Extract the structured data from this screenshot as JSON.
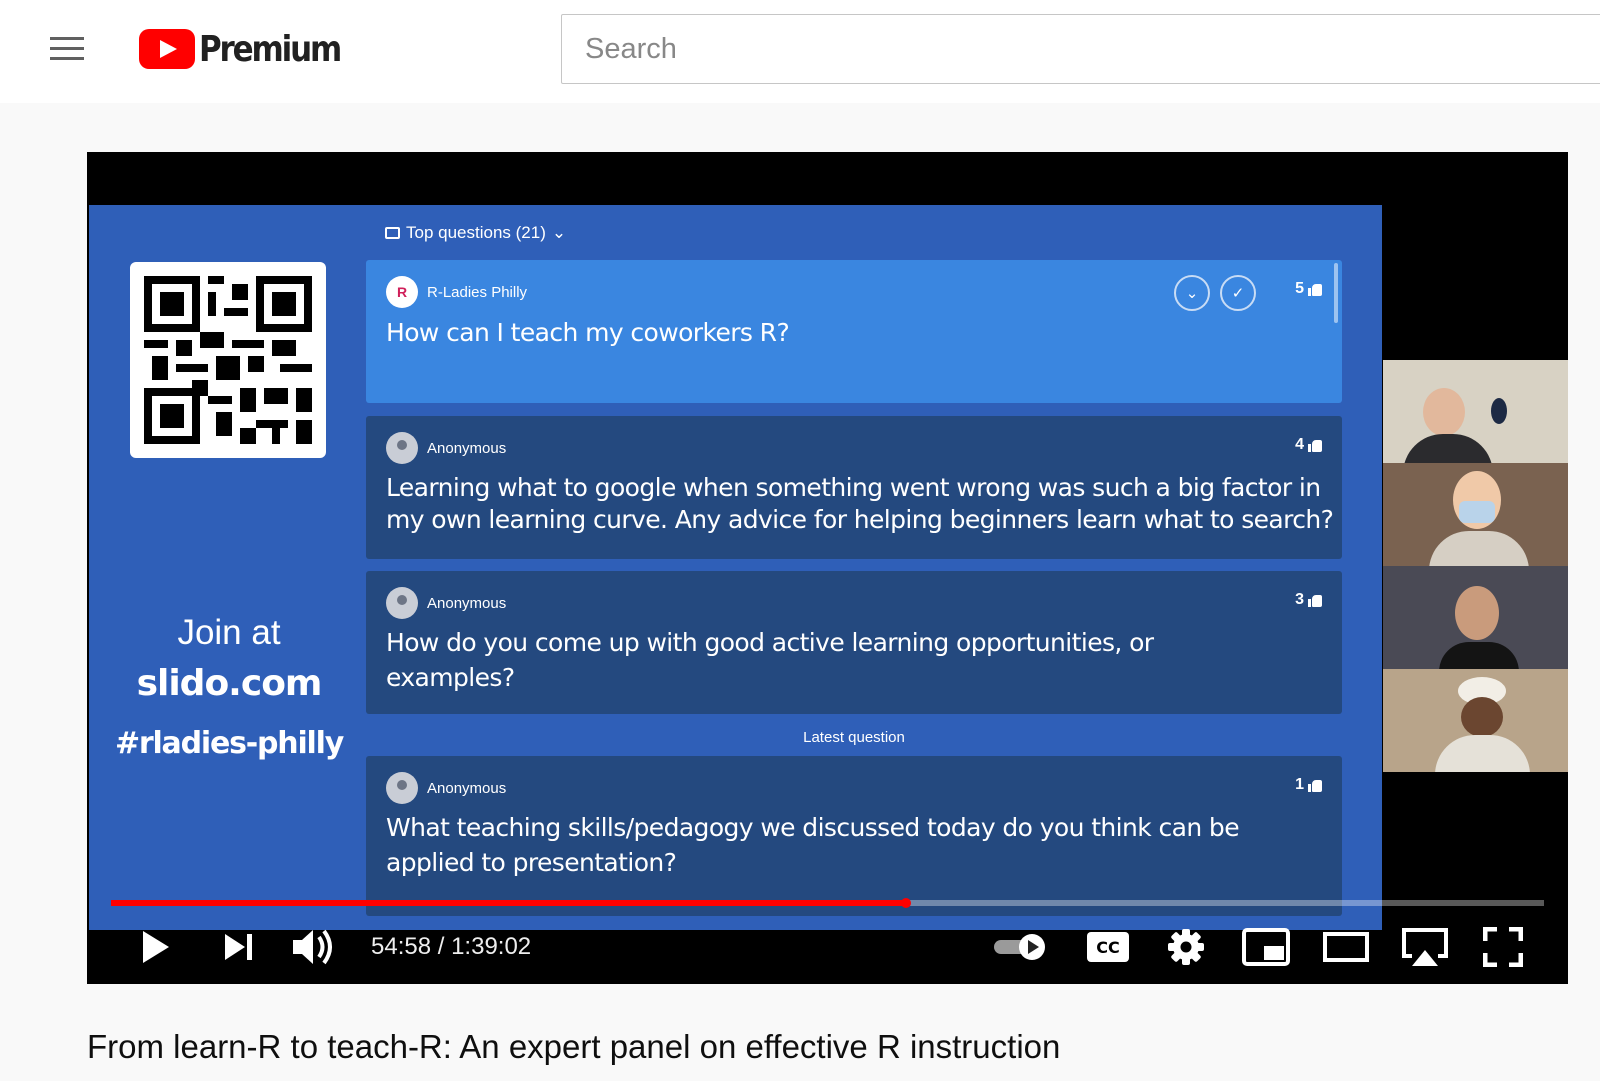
{
  "header": {
    "brand": "Premium",
    "search_placeholder": "Search"
  },
  "slide": {
    "top_questions_label": "Top questions (21)",
    "join_line1": "Join at",
    "join_line2": "slido.com",
    "join_line3": "#rladies-philly",
    "latest_label": "Latest question",
    "questions": [
      {
        "author": "R-Ladies Philly",
        "avatar_letter": "R",
        "votes": "5",
        "text": "How can I teach my coworkers R?"
      },
      {
        "author": "Anonymous",
        "votes": "4",
        "text_line1": "Learning what to google when something went wrong was such a big factor in",
        "text_line2": "my own learning curve. Any advice for helping beginners learn what to search?"
      },
      {
        "author": "Anonymous",
        "votes": "3",
        "text_line1": "How do you come up with good active learning opportunities, or",
        "text_line2": "examples?"
      },
      {
        "author": "Anonymous",
        "votes": "1",
        "text_line1": "What teaching skills/pedagogy we discussed today do you think can be",
        "text_line2": "applied to presentation?"
      }
    ]
  },
  "player": {
    "current_time": "54:58",
    "separator": "/",
    "duration": "1:39:02",
    "progress_fraction": 0.555,
    "cc_label": "CC",
    "accent": "#ff0000"
  },
  "video": {
    "title": "From learn-R to teach-R: An expert panel on effective R instruction"
  }
}
